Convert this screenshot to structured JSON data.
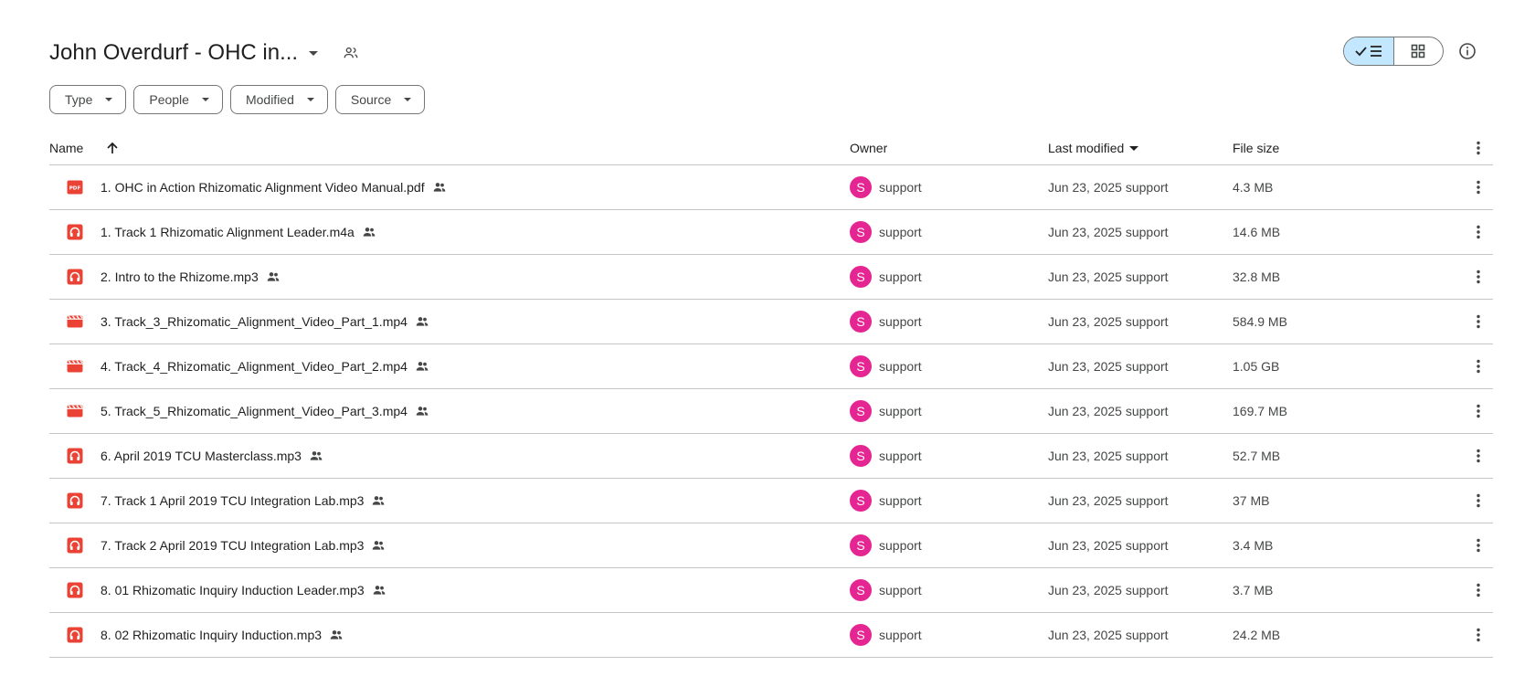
{
  "header": {
    "title": "John Overdurf - OHC in..."
  },
  "filters": [
    "Type",
    "People",
    "Modified",
    "Source"
  ],
  "columns": {
    "name": "Name",
    "owner": "Owner",
    "modified": "Last modified",
    "size": "File size"
  },
  "files": [
    {
      "name": "1. OHC in Action Rhizomatic Alignment Video Manual.pdf",
      "type": "pdf",
      "owner_initial": "S",
      "owner": "support",
      "modified": "Jun 23, 2025 support",
      "size": "4.3 MB"
    },
    {
      "name": "1. Track 1 Rhizomatic Alignment Leader.m4a",
      "type": "audio",
      "owner_initial": "S",
      "owner": "support",
      "modified": "Jun 23, 2025 support",
      "size": "14.6 MB"
    },
    {
      "name": "2. Intro to the Rhizome.mp3",
      "type": "audio",
      "owner_initial": "S",
      "owner": "support",
      "modified": "Jun 23, 2025 support",
      "size": "32.8 MB"
    },
    {
      "name": "3. Track_3_Rhizomatic_Alignment_Video_Part_1.mp4",
      "type": "video",
      "owner_initial": "S",
      "owner": "support",
      "modified": "Jun 23, 2025 support",
      "size": "584.9 MB"
    },
    {
      "name": "4. Track_4_Rhizomatic_Alignment_Video_Part_2.mp4",
      "type": "video",
      "owner_initial": "S",
      "owner": "support",
      "modified": "Jun 23, 2025 support",
      "size": "1.05 GB"
    },
    {
      "name": "5. Track_5_Rhizomatic_Alignment_Video_Part_3.mp4",
      "type": "video",
      "owner_initial": "S",
      "owner": "support",
      "modified": "Jun 23, 2025 support",
      "size": "169.7 MB"
    },
    {
      "name": "6. April 2019 TCU Masterclass.mp3",
      "type": "audio",
      "owner_initial": "S",
      "owner": "support",
      "modified": "Jun 23, 2025 support",
      "size": "52.7 MB"
    },
    {
      "name": "7. Track 1 April 2019 TCU Integration Lab.mp3",
      "type": "audio",
      "owner_initial": "S",
      "owner": "support",
      "modified": "Jun 23, 2025 support",
      "size": "37 MB"
    },
    {
      "name": "7. Track 2 April 2019 TCU Integration Lab.mp3",
      "type": "audio",
      "owner_initial": "S",
      "owner": "support",
      "modified": "Jun 23, 2025 support",
      "size": "3.4 MB"
    },
    {
      "name": "8. 01 Rhizomatic Inquiry Induction Leader.mp3",
      "type": "audio",
      "owner_initial": "S",
      "owner": "support",
      "modified": "Jun 23, 2025 support",
      "size": "3.7 MB"
    },
    {
      "name": "8. 02 Rhizomatic Inquiry Induction.mp3",
      "type": "audio",
      "owner_initial": "S",
      "owner": "support",
      "modified": "Jun 23, 2025 support",
      "size": "24.2 MB"
    }
  ],
  "colors": {
    "file_icon": "#ea4335",
    "avatar": "#e52592",
    "view_active": "#c2e7ff"
  }
}
